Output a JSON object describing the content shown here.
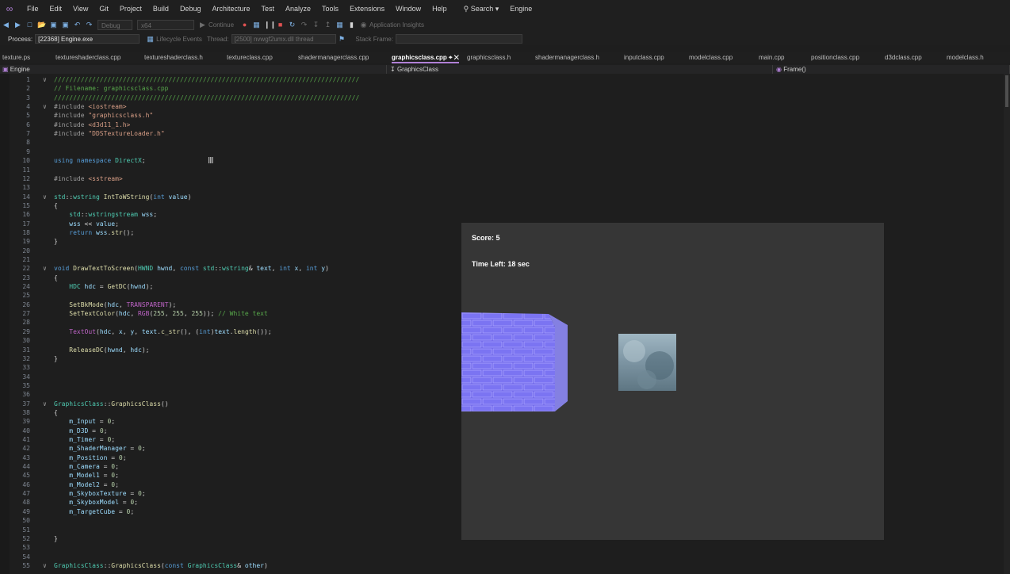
{
  "menu": {
    "items": [
      "File",
      "Edit",
      "View",
      "Git",
      "Project",
      "Build",
      "Debug",
      "Architecture",
      "Test",
      "Analyze",
      "Tools",
      "Extensions",
      "Window",
      "Help"
    ],
    "search_label": "Search",
    "solution_name": "Engine"
  },
  "toolbar": {
    "config": "Debug",
    "platform": "x64",
    "continue_label": "Continue",
    "insights_label": "Application Insights"
  },
  "process_bar": {
    "process_label": "Process:",
    "process_value": "[22368] Engine.exe",
    "lifecycle_label": "Lifecycle Events",
    "thread_label": "Thread:",
    "thread_value": "[2500] nvwgf2umx.dll thread",
    "stack_label": "Stack Frame:"
  },
  "tabs": [
    {
      "label": "texture.ps",
      "active": false
    },
    {
      "label": "textureshaderclass.cpp",
      "active": false
    },
    {
      "label": "textureshaderclass.h",
      "active": false
    },
    {
      "label": "textureclass.cpp",
      "active": false
    },
    {
      "label": "shadermanagerclass.cpp",
      "active": false
    },
    {
      "label": "graphicsclass.cpp",
      "active": true
    },
    {
      "label": "graphicsclass.h",
      "active": false
    },
    {
      "label": "shadermanagerclass.h",
      "active": false
    },
    {
      "label": "inputclass.cpp",
      "active": false
    },
    {
      "label": "modelclass.cpp",
      "active": false
    },
    {
      "label": "main.cpp",
      "active": false
    },
    {
      "label": "positionclass.cpp",
      "active": false
    },
    {
      "label": "d3dclass.cpp",
      "active": false
    },
    {
      "label": "modelclass.h",
      "active": false
    }
  ],
  "nav": {
    "project": "Engine",
    "scope": "GraphicsClass",
    "member": "Frame()"
  },
  "code": [
    {
      "n": "1",
      "fold": "v",
      "parts": [
        [
          "cmt",
          "////////////////////////////////////////////////////////////////////////////////"
        ]
      ]
    },
    {
      "n": "2",
      "parts": [
        [
          "cmt",
          "// Filename: graphicsclass.cpp"
        ]
      ]
    },
    {
      "n": "3",
      "parts": [
        [
          "cmt",
          "////////////////////////////////////////////////////////////////////////////////"
        ]
      ]
    },
    {
      "n": "4",
      "fold": "v",
      "parts": [
        [
          "pp",
          "#include "
        ],
        [
          "str",
          "<iostream>"
        ]
      ]
    },
    {
      "n": "5",
      "parts": [
        [
          "pp",
          "#include "
        ],
        [
          "str",
          "\"graphicsclass.h\""
        ]
      ]
    },
    {
      "n": "6",
      "parts": [
        [
          "pp",
          "#include "
        ],
        [
          "str",
          "<d3d11_1.h>"
        ]
      ]
    },
    {
      "n": "7",
      "parts": [
        [
          "pp",
          "#include "
        ],
        [
          "str",
          "\"DDSTextureLoader.h\""
        ]
      ]
    },
    {
      "n": "8",
      "parts": []
    },
    {
      "n": "9",
      "parts": []
    },
    {
      "n": "10",
      "parts": [
        [
          "kw",
          "using namespace "
        ],
        [
          "typ",
          "DirectX"
        ],
        [
          "txt",
          ";"
        ]
      ]
    },
    {
      "n": "11",
      "parts": []
    },
    {
      "n": "12",
      "parts": [
        [
          "pp",
          "#include "
        ],
        [
          "str",
          "<sstream>"
        ]
      ]
    },
    {
      "n": "13",
      "parts": []
    },
    {
      "n": "14",
      "fold": "v",
      "parts": [
        [
          "typ",
          "std"
        ],
        [
          "txt",
          "::"
        ],
        [
          "typ",
          "wstring "
        ],
        [
          "fn",
          "IntToWString"
        ],
        [
          "txt",
          "("
        ],
        [
          "kw",
          "int "
        ],
        [
          "var",
          "value"
        ],
        [
          "txt",
          ")"
        ]
      ]
    },
    {
      "n": "15",
      "parts": [
        [
          "txt",
          "{"
        ]
      ]
    },
    {
      "n": "16",
      "parts": [
        [
          "txt",
          "    "
        ],
        [
          "typ",
          "std"
        ],
        [
          "txt",
          "::"
        ],
        [
          "typ",
          "wstringstream "
        ],
        [
          "var",
          "wss"
        ],
        [
          "txt",
          ";"
        ]
      ]
    },
    {
      "n": "17",
      "parts": [
        [
          "txt",
          "    "
        ],
        [
          "var",
          "wss"
        ],
        [
          "txt",
          " << "
        ],
        [
          "var",
          "value"
        ],
        [
          "txt",
          ";"
        ]
      ]
    },
    {
      "n": "18",
      "parts": [
        [
          "txt",
          "    "
        ],
        [
          "kw",
          "return "
        ],
        [
          "var",
          "wss"
        ],
        [
          "txt",
          "."
        ],
        [
          "fn",
          "str"
        ],
        [
          "txt",
          "();"
        ]
      ]
    },
    {
      "n": "19",
      "parts": [
        [
          "txt",
          "}"
        ]
      ]
    },
    {
      "n": "20",
      "parts": []
    },
    {
      "n": "21",
      "parts": []
    },
    {
      "n": "22",
      "fold": "v",
      "parts": [
        [
          "kw",
          "void "
        ],
        [
          "fn",
          "DrawTextToScreen"
        ],
        [
          "txt",
          "("
        ],
        [
          "typ",
          "HWND "
        ],
        [
          "var",
          "hwnd"
        ],
        [
          "txt",
          ", "
        ],
        [
          "kw",
          "const "
        ],
        [
          "typ",
          "std"
        ],
        [
          "txt",
          "::"
        ],
        [
          "typ",
          "wstring"
        ],
        [
          "txt",
          "& "
        ],
        [
          "var",
          "text"
        ],
        [
          "txt",
          ", "
        ],
        [
          "kw",
          "int "
        ],
        [
          "var",
          "x"
        ],
        [
          "txt",
          ", "
        ],
        [
          "kw",
          "int "
        ],
        [
          "var",
          "y"
        ],
        [
          "txt",
          ")"
        ]
      ]
    },
    {
      "n": "23",
      "parts": [
        [
          "txt",
          "{"
        ]
      ]
    },
    {
      "n": "24",
      "parts": [
        [
          "txt",
          "    "
        ],
        [
          "typ",
          "HDC "
        ],
        [
          "var",
          "hdc"
        ],
        [
          "txt",
          " = "
        ],
        [
          "fn",
          "GetDC"
        ],
        [
          "txt",
          "("
        ],
        [
          "var",
          "hwnd"
        ],
        [
          "txt",
          ");"
        ]
      ]
    },
    {
      "n": "25",
      "parts": []
    },
    {
      "n": "26",
      "parts": [
        [
          "txt",
          "    "
        ],
        [
          "fn",
          "SetBkMode"
        ],
        [
          "txt",
          "("
        ],
        [
          "var",
          "hdc"
        ],
        [
          "txt",
          ", "
        ],
        [
          "mac",
          "TRANSPARENT"
        ],
        [
          "txt",
          ");"
        ]
      ]
    },
    {
      "n": "27",
      "parts": [
        [
          "txt",
          "    "
        ],
        [
          "fn",
          "SetTextColor"
        ],
        [
          "txt",
          "("
        ],
        [
          "var",
          "hdc"
        ],
        [
          "txt",
          ", "
        ],
        [
          "mac",
          "RGB"
        ],
        [
          "txt",
          "("
        ],
        [
          "num",
          "255"
        ],
        [
          "txt",
          ", "
        ],
        [
          "num",
          "255"
        ],
        [
          "txt",
          ", "
        ],
        [
          "num",
          "255"
        ],
        [
          "txt",
          "));"
        ],
        [
          "cmt",
          " // White text"
        ]
      ]
    },
    {
      "n": "28",
      "parts": []
    },
    {
      "n": "29",
      "parts": [
        [
          "txt",
          "    "
        ],
        [
          "mac",
          "TextOut"
        ],
        [
          "txt",
          "("
        ],
        [
          "var",
          "hdc"
        ],
        [
          "txt",
          ", "
        ],
        [
          "var",
          "x"
        ],
        [
          "txt",
          ", "
        ],
        [
          "var",
          "y"
        ],
        [
          "txt",
          ", "
        ],
        [
          "var",
          "text"
        ],
        [
          "txt",
          "."
        ],
        [
          "fn",
          "c_str"
        ],
        [
          "txt",
          "(), ("
        ],
        [
          "kw",
          "int"
        ],
        [
          "txt",
          ")"
        ],
        [
          "var",
          "text"
        ],
        [
          "txt",
          "."
        ],
        [
          "fn",
          "length"
        ],
        [
          "txt",
          "());"
        ]
      ]
    },
    {
      "n": "30",
      "parts": []
    },
    {
      "n": "31",
      "parts": [
        [
          "txt",
          "    "
        ],
        [
          "fn",
          "ReleaseDC"
        ],
        [
          "txt",
          "("
        ],
        [
          "var",
          "hwnd"
        ],
        [
          "txt",
          ", "
        ],
        [
          "var",
          "hdc"
        ],
        [
          "txt",
          ");"
        ]
      ]
    },
    {
      "n": "32",
      "parts": [
        [
          "txt",
          "}"
        ]
      ]
    },
    {
      "n": "33",
      "parts": []
    },
    {
      "n": "34",
      "parts": []
    },
    {
      "n": "35",
      "parts": []
    },
    {
      "n": "36",
      "parts": []
    },
    {
      "n": "37",
      "fold": "v",
      "parts": [
        [
          "typ",
          "GraphicsClass"
        ],
        [
          "txt",
          "::"
        ],
        [
          "fn",
          "GraphicsClass"
        ],
        [
          "txt",
          "()"
        ]
      ]
    },
    {
      "n": "38",
      "parts": [
        [
          "txt",
          "{"
        ]
      ]
    },
    {
      "n": "39",
      "parts": [
        [
          "txt",
          "    "
        ],
        [
          "var",
          "m_Input"
        ],
        [
          "txt",
          " = "
        ],
        [
          "num",
          "0"
        ],
        [
          "txt",
          ";"
        ]
      ]
    },
    {
      "n": "40",
      "parts": [
        [
          "txt",
          "    "
        ],
        [
          "var",
          "m_D3D"
        ],
        [
          "txt",
          " = "
        ],
        [
          "num",
          "0"
        ],
        [
          "txt",
          ";"
        ]
      ]
    },
    {
      "n": "41",
      "parts": [
        [
          "txt",
          "    "
        ],
        [
          "var",
          "m_Timer"
        ],
        [
          "txt",
          " = "
        ],
        [
          "num",
          "0"
        ],
        [
          "txt",
          ";"
        ]
      ]
    },
    {
      "n": "42",
      "parts": [
        [
          "txt",
          "    "
        ],
        [
          "var",
          "m_ShaderManager"
        ],
        [
          "txt",
          " = "
        ],
        [
          "num",
          "0"
        ],
        [
          "txt",
          ";"
        ]
      ]
    },
    {
      "n": "43",
      "parts": [
        [
          "txt",
          "    "
        ],
        [
          "var",
          "m_Position"
        ],
        [
          "txt",
          " = "
        ],
        [
          "num",
          "0"
        ],
        [
          "txt",
          ";"
        ]
      ]
    },
    {
      "n": "44",
      "parts": [
        [
          "txt",
          "    "
        ],
        [
          "var",
          "m_Camera"
        ],
        [
          "txt",
          " = "
        ],
        [
          "num",
          "0"
        ],
        [
          "txt",
          ";"
        ]
      ]
    },
    {
      "n": "45",
      "parts": [
        [
          "txt",
          "    "
        ],
        [
          "var",
          "m_Model1"
        ],
        [
          "txt",
          " = "
        ],
        [
          "num",
          "0"
        ],
        [
          "txt",
          ";"
        ]
      ]
    },
    {
      "n": "46",
      "parts": [
        [
          "txt",
          "    "
        ],
        [
          "var",
          "m_Model2"
        ],
        [
          "txt",
          " = "
        ],
        [
          "num",
          "0"
        ],
        [
          "txt",
          ";"
        ]
      ]
    },
    {
      "n": "47",
      "parts": [
        [
          "txt",
          "    "
        ],
        [
          "var",
          "m_SkyboxTexture"
        ],
        [
          "txt",
          " = "
        ],
        [
          "num",
          "0"
        ],
        [
          "txt",
          ";"
        ]
      ]
    },
    {
      "n": "48",
      "parts": [
        [
          "txt",
          "    "
        ],
        [
          "var",
          "m_SkyboxModel"
        ],
        [
          "txt",
          " = "
        ],
        [
          "num",
          "0"
        ],
        [
          "txt",
          ";"
        ]
      ]
    },
    {
      "n": "49",
      "parts": [
        [
          "txt",
          "    "
        ],
        [
          "var",
          "m_TargetCube"
        ],
        [
          "txt",
          " = "
        ],
        [
          "num",
          "0"
        ],
        [
          "txt",
          ";"
        ]
      ]
    },
    {
      "n": "50",
      "parts": []
    },
    {
      "n": "51",
      "parts": []
    },
    {
      "n": "52",
      "parts": [
        [
          "txt",
          "}"
        ]
      ]
    },
    {
      "n": "53",
      "parts": []
    },
    {
      "n": "54",
      "parts": []
    },
    {
      "n": "55",
      "fold": "v",
      "parts": [
        [
          "typ",
          "GraphicsClass"
        ],
        [
          "txt",
          "::"
        ],
        [
          "fn",
          "GraphicsClass"
        ],
        [
          "txt",
          "("
        ],
        [
          "kw",
          "const "
        ],
        [
          "typ",
          "GraphicsClass"
        ],
        [
          "txt",
          "& "
        ],
        [
          "var",
          "other"
        ],
        [
          "txt",
          ")"
        ]
      ]
    }
  ],
  "game": {
    "score": "Score: 5",
    "time_left": "Time Left: 18 sec"
  },
  "colors": {
    "accent": "#b180d7",
    "game_bg": "#363636",
    "cube": "#7a6ff0"
  }
}
